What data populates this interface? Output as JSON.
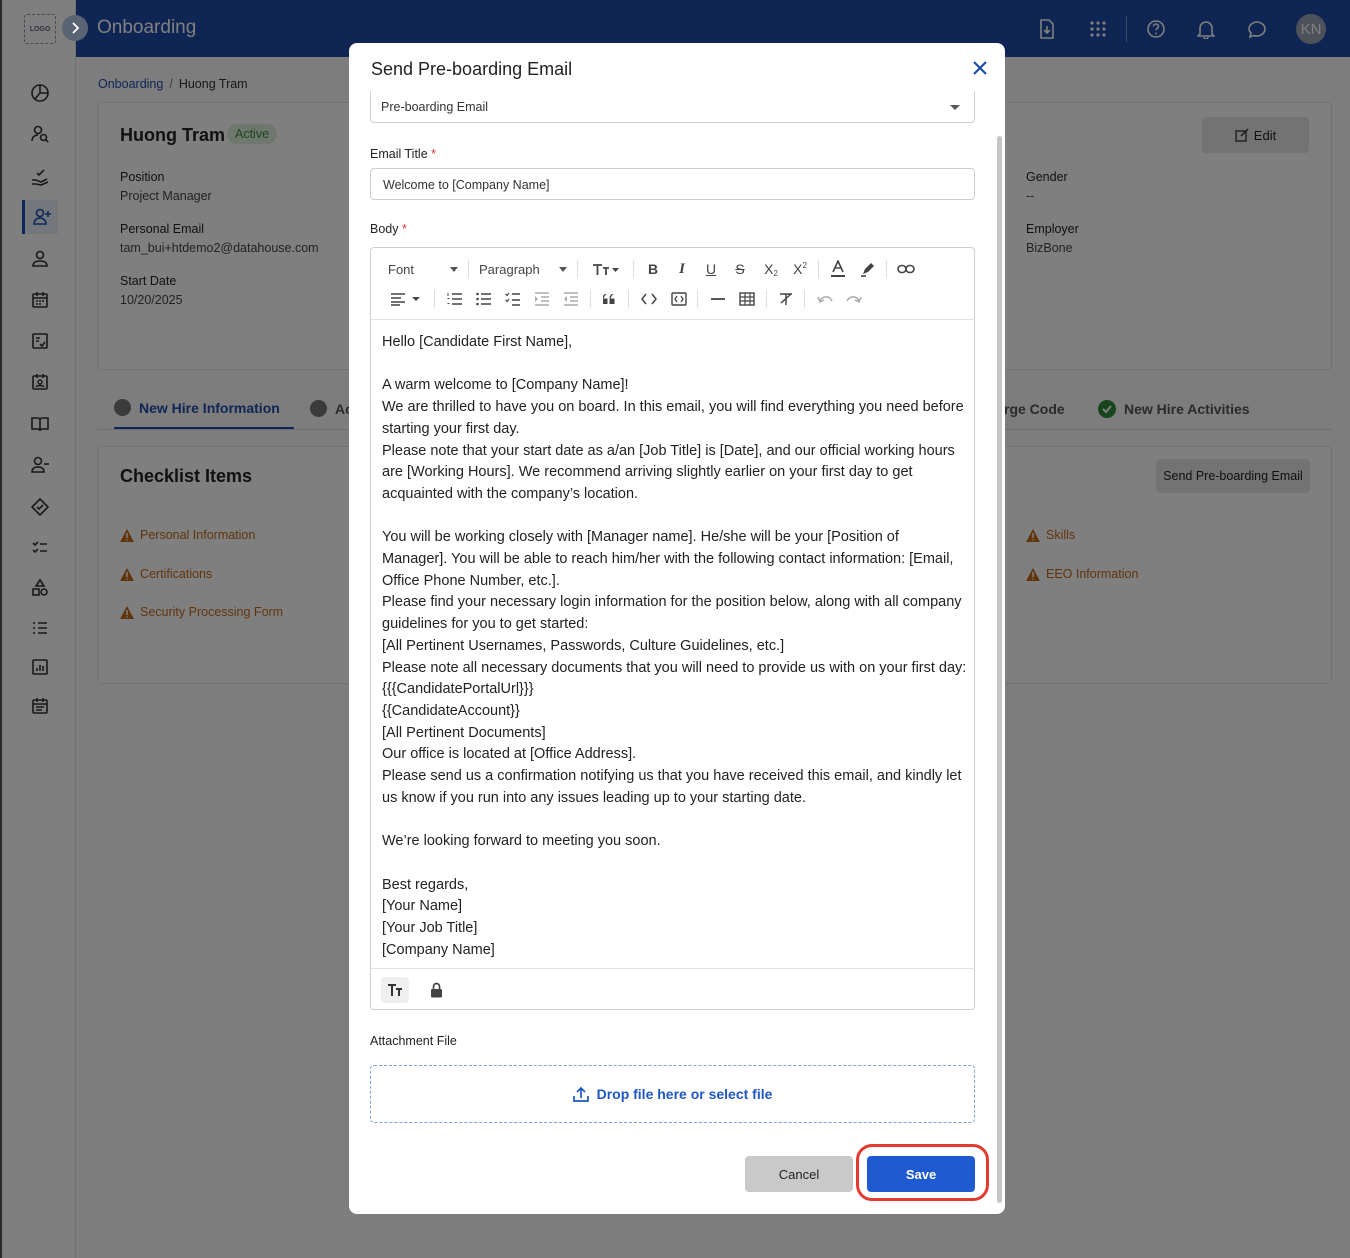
{
  "app": {
    "logo_text": "LOGO",
    "title": "Onboarding",
    "avatar_initials": "KN"
  },
  "breadcrumb": {
    "parent": "Onboarding",
    "separator": "/",
    "current": "Huong Tram"
  },
  "profile": {
    "name": "Huong Tram",
    "status": "Active",
    "edit_label": "Edit",
    "fields": [
      {
        "label": "Position",
        "value": "Project Manager"
      },
      {
        "label": "Personal Email",
        "value": "tam_bui+htdemo2@datahouse.com"
      },
      {
        "label": "Start Date",
        "value": "10/20/2025"
      },
      {
        "label": "Gender",
        "value": "--"
      },
      {
        "label": "Employer",
        "value": "BizBone"
      }
    ]
  },
  "tabs": [
    {
      "label": "New Hire Information"
    },
    {
      "label": "Ac"
    },
    {
      "label": "rge Code"
    },
    {
      "label": "New Hire Activities"
    }
  ],
  "checklist": {
    "title": "Checklist Items",
    "send_label": "Send Pre-boarding Email",
    "items": [
      "Personal Information",
      "Certifications",
      "Security Processing Form",
      "Skills",
      "EEO Information"
    ]
  },
  "modal": {
    "title": "Send Pre-boarding Email",
    "template_value": "Pre-boarding Email",
    "email_title_label": "Email Title",
    "required_mark": "*",
    "email_title_value": "Welcome to [Company Name]",
    "body_label": "Body",
    "toolbar": {
      "font": "Font",
      "paragraph": "Paragraph"
    },
    "body_lines": [
      "Hello [Candidate First Name],",
      "",
      "A warm welcome to [Company Name]!",
      "We are thrilled to have you on board. In this email, you will find everything you need before starting your first day.",
      "Please note that your start date as a/an [Job Title] is [Date], and our official working hours are [Working Hours]. We recommend arriving slightly earlier on your first day to get acquainted with the company’s location.",
      "",
      "You will be working closely with [Manager name]. He/she will be your [Position of Manager]. You will be able to reach him/her with the following contact information: [Email, Office Phone Number, etc.].",
      "Please find your necessary login information for the position below, along with all company guidelines for you to get started:",
      "[All Pertinent Usernames, Passwords, Culture Guidelines, etc.]",
      "Please note all necessary documents that you will need to provide us with on your first day:",
      "{{{CandidatePortalUrl}}}",
      "{{CandidateAccount}}",
      "[All Pertinent Documents]",
      "Our office is located at [Office Address].",
      "Please send us a confirmation notifying us that you have received this email, and kindly let us know if you run into any issues leading up to your starting date.",
      "",
      "We’re looking forward to meeting you soon.",
      "",
      "Best regards,",
      "[Your Name]",
      "[Your Job Title]",
      "[Company Name]"
    ],
    "attachment_label": "Attachment File",
    "drop_label": "Drop file here or select file",
    "cancel_label": "Cancel",
    "save_label": "Save"
  },
  "colors": {
    "primary": "#1e4aa8",
    "save": "#1f5bd0",
    "warning": "#c06a1d",
    "highlight": "#e23b2e"
  }
}
